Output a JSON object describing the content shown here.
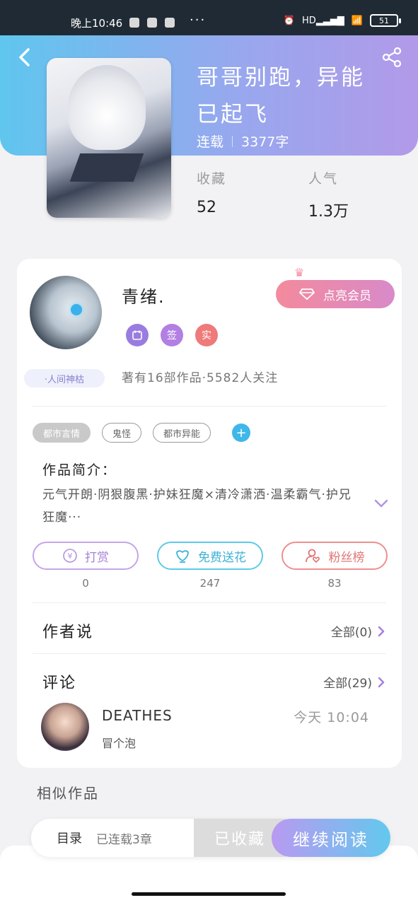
{
  "status_bar": {
    "time": "晚上10:46",
    "dots": "···",
    "network": "HD",
    "battery": "51"
  },
  "book": {
    "title": "哥哥别跑，异能已起飞",
    "status": "连载",
    "word_count": "3377字",
    "stats": [
      {
        "label": "收藏",
        "value": "52"
      },
      {
        "label": "人气",
        "value": "1.3万"
      }
    ]
  },
  "author": {
    "name": "青绪.",
    "badges": [
      {
        "icon": "calendar-icon",
        "color": "#9a7ce0"
      },
      {
        "text": "签",
        "color": "#b27fe2"
      },
      {
        "text": "实",
        "color": "#ee7a7a"
      }
    ],
    "tag": "·人间神枯",
    "info": "著有16部作品·5582人关注",
    "vip_button": "点亮会员"
  },
  "tags": [
    "都市言情",
    "鬼怪",
    "都市异能"
  ],
  "intro": {
    "title": "作品简介：",
    "text": "元气开朗·阴狠腹黑·护妹狂魔×清冷潇洒·温柔霸气·护兄狂魔···"
  },
  "actions": [
    {
      "label": "打赏",
      "count": "0"
    },
    {
      "label": "免费送花",
      "count": "247"
    },
    {
      "label": "粉丝榜",
      "count": "83"
    }
  ],
  "author_says": {
    "title": "作者说",
    "link": "全部(0)"
  },
  "comments": {
    "title": "评论",
    "link": "全部(29)",
    "items": [
      {
        "user": "DEATHES",
        "time": "今天 10:04",
        "text": "冒个泡"
      }
    ]
  },
  "similar": {
    "title": "相似作品"
  },
  "bottom_bar": {
    "toc": "目录",
    "toc_sub": "已连载3章",
    "collected": "已收藏",
    "continue": "继续阅读"
  },
  "colors": {
    "header_gradient_start": "#5fc6ee",
    "header_gradient_end": "#b29ae9",
    "accent_blue": "#3fb7e9",
    "vip_pink": "#f48a9c"
  }
}
